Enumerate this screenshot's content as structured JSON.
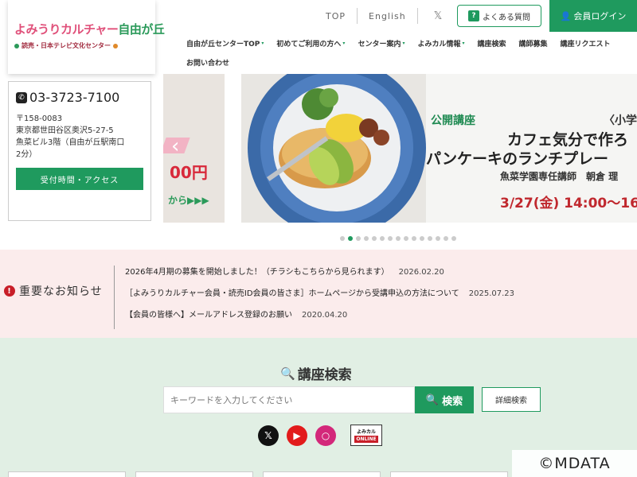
{
  "logo": {
    "main_a": "よみうりカルチャー",
    "main_b": "自由が丘",
    "sub": "読売・日本テレビ文化センター"
  },
  "top": {
    "links": [
      "TOP",
      "English"
    ],
    "faq": "よくある質問",
    "login": "会員ログイン"
  },
  "nav": {
    "row1": [
      "自由が丘センターTOP",
      "初めてご利用の方へ",
      "センター案内",
      "よみカル情報",
      "講座検索",
      "講師募集",
      "講座リクエスト"
    ],
    "row1_dropdown": [
      true,
      true,
      true,
      true,
      false,
      false,
      false
    ],
    "row2": [
      "お問い合わせ"
    ]
  },
  "contact": {
    "phone": "03-3723-7100",
    "address": [
      "〒158-0083",
      "東京都世田谷区奥沢5-27-5",
      "魚菜ビル3階（自由が丘駅南口",
      "2分）"
    ],
    "access_button": "受付時間・アクセス"
  },
  "slider": {
    "prev": {
      "price": "00円",
      "kara": "から▶▶▶"
    },
    "main": {
      "tag": "公開講座",
      "kids": "〈小学",
      "title_line1": "カフェ気分で作ろ",
      "title_line2": "パンケーキのランチプレー",
      "instructor": "魚菜学園専任講師　朝倉 理",
      "datetime": "3/27(金) 14:00〜16"
    },
    "dot_count": 15,
    "active_dot": 1
  },
  "notice": {
    "heading": "重要なお知らせ",
    "items": [
      {
        "text": "2026年4月期の募集を開始しました！（チラシもこちらから見られます）",
        "date": "2026.02.20"
      },
      {
        "text": "［よみうりカルチャー会員・読売ID会員の皆さま］ホームページから受講申込の方法について",
        "date": "2025.07.23"
      },
      {
        "text": "【会員の皆様へ】メールアドレス登録のお願い",
        "date": "2020.04.20"
      }
    ]
  },
  "search": {
    "title": "講座検索",
    "placeholder": "キーワードを入力してください",
    "button": "検索",
    "advanced": "詳細検索"
  },
  "social": {
    "online_top": "よみカル",
    "online_bottom": "ONLINE"
  },
  "watermark": "©MDATA",
  "colors": {
    "brand_green": "#1f9a5e",
    "notice_bg": "#fbecec",
    "search_bg": "#e1efe4",
    "alert_red": "#c81e28"
  }
}
